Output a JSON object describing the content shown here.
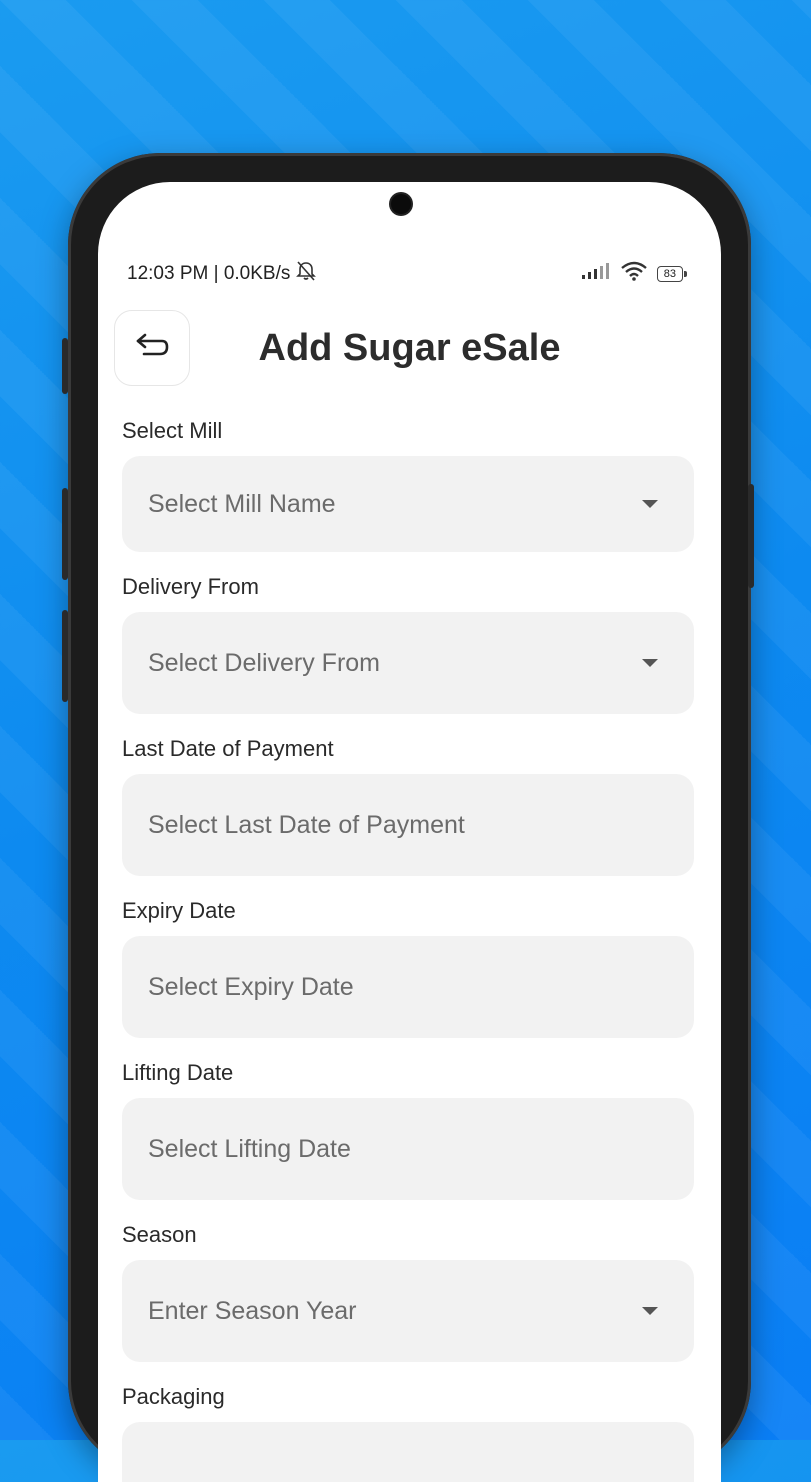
{
  "status_bar": {
    "time_speed": "12:03 PM | 0.0KB/s",
    "battery": "83"
  },
  "header": {
    "title": "Add Sugar eSale"
  },
  "form": {
    "fields": [
      {
        "label": "Select Mill",
        "placeholder": "Select Mill Name"
      },
      {
        "label": "Delivery From",
        "placeholder": "Select Delivery From"
      },
      {
        "label": "Last Date of Payment",
        "placeholder": "Select Last Date of Payment"
      },
      {
        "label": "Expiry Date",
        "placeholder": "Select Expiry Date"
      },
      {
        "label": "Lifting Date",
        "placeholder": "Select Lifting Date"
      },
      {
        "label": "Season",
        "placeholder": "Enter Season Year"
      },
      {
        "label": "Packaging",
        "placeholder": ""
      }
    ]
  },
  "icons": {
    "back": "back-arrow-icon",
    "dropdown": "caret-down-icon",
    "mute": "bell-off-icon",
    "signal": "signal-icon",
    "wifi": "wifi-icon",
    "battery": "battery-icon"
  }
}
